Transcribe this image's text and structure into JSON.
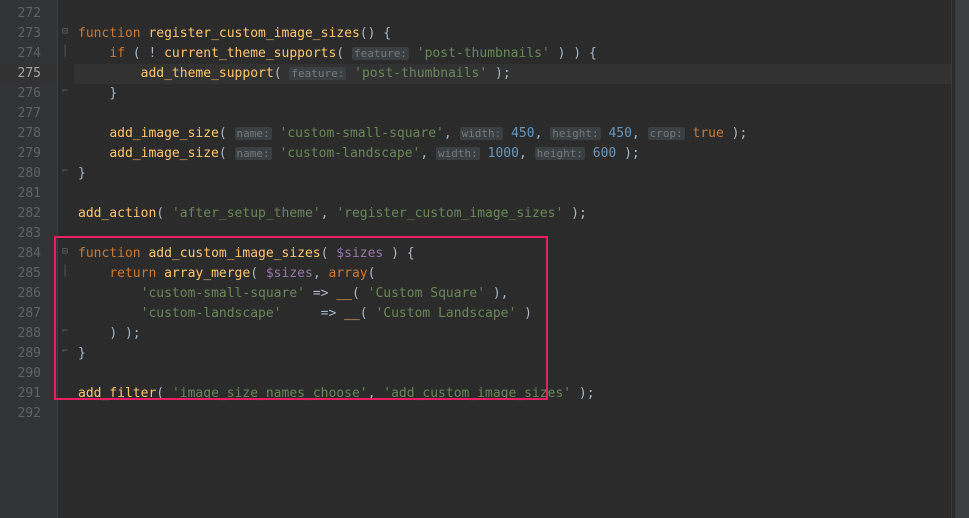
{
  "lines": {
    "l272": "272",
    "l273": "273",
    "l274": "274",
    "l275": "275",
    "l276": "276",
    "l277": "277",
    "l278": "278",
    "l279": "279",
    "l280": "280",
    "l281": "281",
    "l282": "282",
    "l283": "283",
    "l284": "284",
    "l285": "285",
    "l286": "286",
    "l287": "287",
    "l288": "288",
    "l289": "289",
    "l290": "290",
    "l291": "291",
    "l292": "292"
  },
  "code": {
    "l273": {
      "kw": "function",
      "fn": " register_custom_image_sizes",
      "rest": "() {"
    },
    "l274": {
      "indent": "    ",
      "kw": "if",
      "p1": " ( ! ",
      "fn": "current_theme_supports",
      "p2": "( ",
      "hint": "feature:",
      "sp": " ",
      "str": "'post-thumbnails'",
      "p3": " ) ) {"
    },
    "l275": {
      "indent": "        ",
      "fn": "add_theme_support",
      "p1": "( ",
      "hint": "feature:",
      "sp": " ",
      "str": "'post-thumbnails'",
      "p2": " );"
    },
    "l276": {
      "indent": "    ",
      "p": "}"
    },
    "l278": {
      "indent": "    ",
      "fn": "add_image_size",
      "p1": "( ",
      "hint1": "name:",
      "sp1": " ",
      "str1": "'custom-small-square'",
      "c1": ", ",
      "hint2": "width:",
      "sp2": " ",
      "num1": "450",
      "c2": ", ",
      "hint3": "height:",
      "sp3": " ",
      "num2": "450",
      "c3": ", ",
      "hint4": "crop:",
      "sp4": " ",
      "kw": "true",
      "p2": " );"
    },
    "l279": {
      "indent": "    ",
      "fn": "add_image_size",
      "p1": "( ",
      "hint1": "name:",
      "sp1": " ",
      "str1": "'custom-landscape'",
      "c1": ", ",
      "hint2": "width:",
      "sp2": " ",
      "num1": "1000",
      "c2": ", ",
      "hint3": "height:",
      "sp3": " ",
      "num2": "600",
      "p2": " );"
    },
    "l280": {
      "p": "}"
    },
    "l282": {
      "fn": "add_action",
      "p1": "( ",
      "str1": "'after_setup_theme'",
      "c": ", ",
      "str2": "'register_custom_image_sizes'",
      "p2": " );"
    },
    "l284": {
      "kw": "function",
      "fn": " add_custom_image_sizes",
      "p1": "( ",
      "var": "$sizes",
      "p2": " ) {"
    },
    "l285": {
      "indent": "    ",
      "kw": "return",
      "sp": " ",
      "fn1": "array_merge",
      "p1": "( ",
      "var": "$sizes",
      "c": ", ",
      "fn2": "array",
      "p2": "("
    },
    "l286": {
      "indent": "        ",
      "str1": "'custom-small-square'",
      "arrow": " => ",
      "fn": "__",
      "p1": "( ",
      "str2": "'Custom Square'",
      "p2": " ),"
    },
    "l287": {
      "indent": "        ",
      "str1": "'custom-landscape'",
      "pad": "    ",
      "arrow": " => ",
      "fn": "__",
      "p1": "( ",
      "str2": "'Custom Landscape'",
      "p2": " )"
    },
    "l288": {
      "indent": "    ",
      "p": ") );"
    },
    "l289": {
      "p": "}"
    },
    "l291": {
      "fn": "add_filter",
      "p1": "( ",
      "str1": "'image_size_names_choose'",
      "c": ", ",
      "str2": "'add_custom_image_sizes'",
      "p2": " );"
    }
  }
}
